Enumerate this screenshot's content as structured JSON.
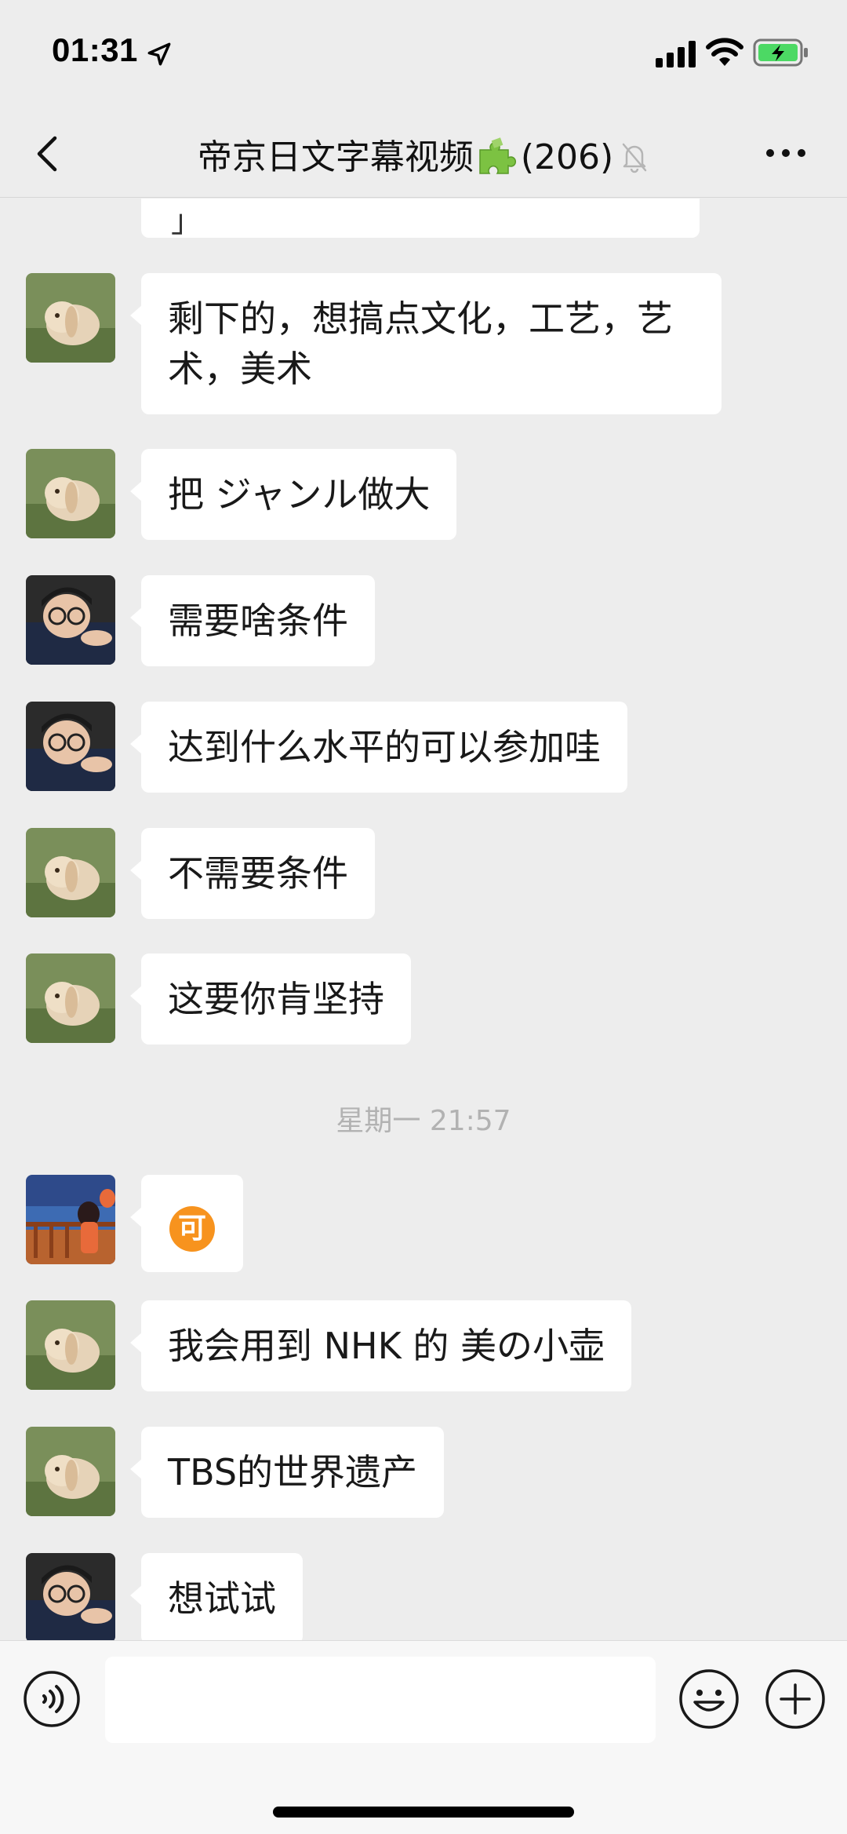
{
  "status_bar": {
    "time": "01:31",
    "location_icon": "location-arrow-icon",
    "signal_icon": "cellular-signal-icon",
    "wifi_icon": "wifi-icon",
    "battery_icon": "battery-charging-icon",
    "battery_color": "#4cd964"
  },
  "nav": {
    "back_icon": "chevron-left-icon",
    "title": "帝京日文字幕视频",
    "title_emoji": "puzzle-piece-icon",
    "member_count": "(206)",
    "mute_icon": "bell-slash-icon",
    "more_icon": "ellipsis-icon"
  },
  "messages": [
    {
      "avatar": "rabbit-avatar",
      "text": "剩下的，想搞点文化，工艺，艺术，美术"
    },
    {
      "avatar": "rabbit-avatar",
      "text": "把 ジャンル做大"
    },
    {
      "avatar": "boy-glasses-avatar",
      "text": "需要啥条件"
    },
    {
      "avatar": "boy-glasses-avatar",
      "text": "达到什么水平的可以参加哇"
    },
    {
      "avatar": "rabbit-avatar",
      "text": "不需要条件"
    },
    {
      "avatar": "rabbit-avatar",
      "text": "这要你肯坚持"
    },
    {
      "avatar": "girl-seaside-avatar",
      "emoji": "可"
    },
    {
      "avatar": "rabbit-avatar",
      "text": "我会用到 NHK 的 美の小壶"
    },
    {
      "avatar": "rabbit-avatar",
      "text": "TBS的世界遗产"
    },
    {
      "avatar": "boy-glasses-avatar",
      "text": "想试试"
    }
  ],
  "timestamp": "星期一 21:57",
  "partial_top_text": "」",
  "input_bar": {
    "voice_icon": "voice-input-icon",
    "emoji_icon": "smiley-face-icon",
    "plus_icon": "plus-circle-icon",
    "input_value": ""
  }
}
